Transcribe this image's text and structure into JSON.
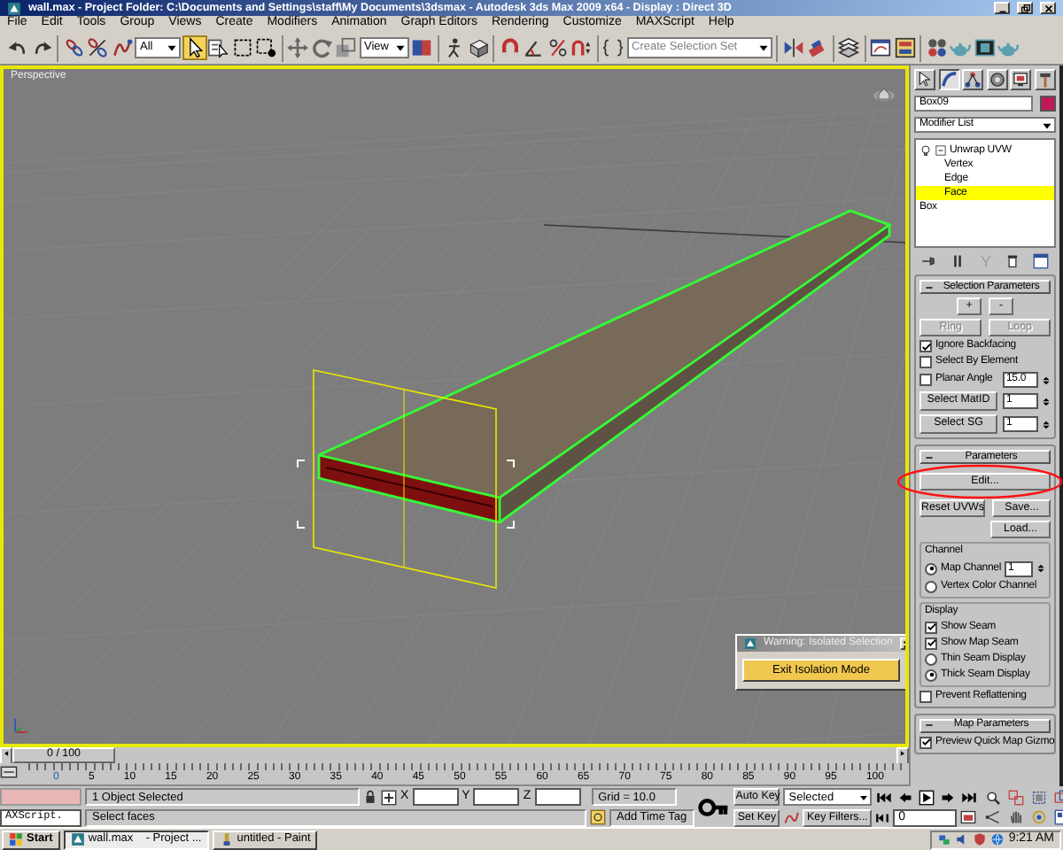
{
  "window": {
    "title": "wall.max  - Project Folder: C:\\Documents and Settings\\staff\\My Documents\\3dsmax  - Autodesk 3ds Max  2009 x64   - Display : Direct 3D"
  },
  "menu": [
    "File",
    "Edit",
    "Tools",
    "Group",
    "Views",
    "Create",
    "Modifiers",
    "Animation",
    "Graph Editors",
    "Rendering",
    "Customize",
    "MAXScript",
    "Help"
  ],
  "toolbar": {
    "selection_filter": "All",
    "reference_coordinates": "View",
    "named_selection_placeholder": "Create Selection Set"
  },
  "viewport": {
    "label": "Perspective"
  },
  "dialog": {
    "title": "Warning: Isolated Selection",
    "button": "Exit Isolation Mode"
  },
  "command_panel": {
    "tabs": [
      {
        "selected": false
      },
      {
        "selected": true
      },
      {
        "selected": false
      },
      {
        "selected": false
      },
      {
        "selected": false
      },
      {
        "selected": false
      }
    ],
    "object": {
      "name": "Box09",
      "color": "#c0185a"
    },
    "modifier_list": "Modifier List",
    "modifier_stack": [
      {
        "label": "Unwrap UVW",
        "selected": false,
        "expanded": true,
        "children": [
          {
            "label": "Vertex",
            "selected": false
          },
          {
            "label": "Edge",
            "selected": false
          },
          {
            "label": "Face",
            "selected": true
          }
        ]
      },
      {
        "label": "Box",
        "selected": false
      }
    ],
    "rollouts": [
      {
        "title": "Selection Parameters",
        "expanded": true,
        "controls": [
          {
            "kind": "buttons",
            "buttons": [
              {
                "label": "+",
                "disabled": false
              },
              {
                "label": "-",
                "disabled": false
              }
            ]
          },
          {
            "kind": "buttons",
            "buttons": [
              {
                "label": "Ring",
                "disabled": true
              },
              {
                "label": "Loop",
                "disabled": true
              }
            ]
          },
          {
            "kind": "checkbox",
            "label": "Ignore Backfacing",
            "checked": true
          },
          {
            "kind": "checkbox",
            "label": "Select By Element",
            "checked": false
          },
          {
            "kind": "checkbox",
            "label": "Planar Angle",
            "checked": false,
            "value": "15.0"
          },
          {
            "kind": "button_spinner",
            "label": "Select MatID",
            "value": "1"
          },
          {
            "kind": "button_spinner",
            "label": "Select SG",
            "value": "1"
          }
        ]
      },
      {
        "title": "Parameters",
        "expanded": true,
        "controls": [
          {
            "kind": "buttons",
            "buttons": [
              {
                "label": "Edit...",
                "disabled": false
              }
            ]
          },
          {
            "kind": "buttons",
            "buttons": [
              {
                "label": "Reset UVWs",
                "disabled": false
              },
              {
                "label": "Save...",
                "disabled": false
              }
            ]
          },
          {
            "kind": "button_right",
            "label": "Load..."
          },
          {
            "kind": "group",
            "title": "Channel",
            "controls": [
              {
                "kind": "radio",
                "label": "Map Channel",
                "selected": true,
                "value": "1"
              },
              {
                "kind": "radio",
                "label": "Vertex Color Channel",
                "selected": false
              }
            ]
          },
          {
            "kind": "group",
            "title": "Display",
            "controls": [
              {
                "kind": "checkbox",
                "label": "Show Seam",
                "checked": true
              },
              {
                "kind": "checkbox",
                "label": "Show Map Seam",
                "checked": true
              },
              {
                "kind": "radio",
                "label": "Thin Seam Display",
                "selected": false
              },
              {
                "kind": "radio",
                "label": "Thick Seam Display",
                "selected": true
              }
            ]
          },
          {
            "kind": "checkbox",
            "label": "Prevent Reflattening",
            "checked": false
          }
        ]
      },
      {
        "title": "Map Parameters",
        "expanded": true,
        "controls": [
          {
            "kind": "checkbox",
            "label": "Preview Quick Map Gizmo",
            "checked": true
          }
        ]
      }
    ]
  },
  "time_slider": {
    "label": "0 / 100",
    "level": 0
  },
  "trackbar": {
    "ticks": [
      "0",
      "5",
      "10",
      "15",
      "20",
      "25",
      "30",
      "35",
      "40",
      "45",
      "50",
      "55",
      "60",
      "65",
      "70",
      "75",
      "80",
      "85",
      "90",
      "95",
      "100"
    ]
  },
  "status_bar": {
    "listener_text": "AXScript.",
    "selection_info": "1 Object Selected",
    "prompt": "Select faces",
    "x_label": "X",
    "y_label": "Y",
    "z_label": "Z",
    "grid": "Grid = 10.0",
    "time_tag": "Add Time Tag"
  },
  "animation_controls": {
    "auto_key": "Auto Key",
    "key_mode": "Selected",
    "set_key": "Set Key",
    "key_filters": "Key Filters...",
    "frame": "0"
  },
  "taskbar": {
    "start": "Start",
    "tasks": [
      {
        "label": "wall.max    - Project ...",
        "selected": true
      },
      {
        "label": "untitled - Paint",
        "selected": false
      }
    ],
    "clock": "9:21 AM"
  }
}
